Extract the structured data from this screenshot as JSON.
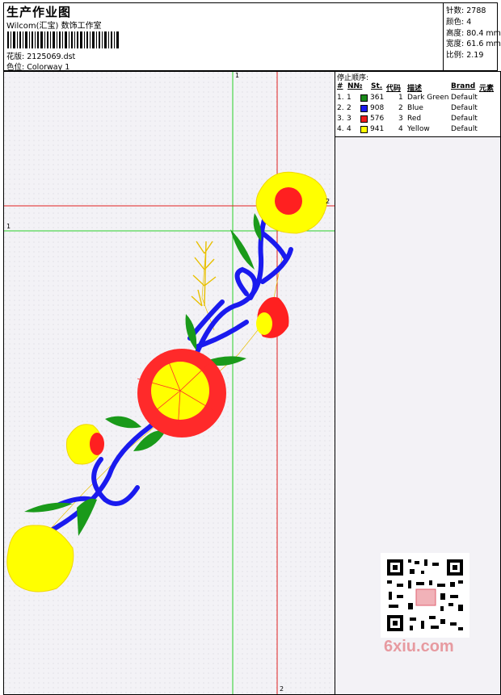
{
  "header": {
    "title": "生产作业图",
    "subtitle": "Wilcom(汇宝) 数饰工作室",
    "design_label": "花版:",
    "design_value": "2125069.dst",
    "colorway_label": "色位:",
    "colorway_value": "Colorway 1"
  },
  "stats": {
    "stitches_label": "针数:",
    "stitches_value": "2788",
    "colors_label": "颜色:",
    "colors_value": "4",
    "height_label": "高度:",
    "height_value": "80.4 mm",
    "width_label": "宽度:",
    "width_value": "61.6 mm",
    "ratio_label": "比例:",
    "ratio_value": "2.19"
  },
  "legend": {
    "title": "停止顺序:",
    "headers": {
      "num": "#",
      "no": "N№",
      "st": "St.",
      "code": "代码",
      "desc": "描述",
      "brand": "Brand",
      "elem": "元素"
    },
    "rows": [
      {
        "num": "1.",
        "no": "1",
        "st": "361",
        "code": "1",
        "desc": "Dark Green",
        "brand": "Default",
        "color": "#1a8a1a"
      },
      {
        "num": "2.",
        "no": "2",
        "st": "908",
        "code": "2",
        "desc": "Blue",
        "brand": "Default",
        "color": "#1a1aee"
      },
      {
        "num": "3.",
        "no": "3",
        "st": "576",
        "code": "3",
        "desc": "Red",
        "brand": "Default",
        "color": "#ee1a1a"
      },
      {
        "num": "4.",
        "no": "4",
        "st": "941",
        "code": "4",
        "desc": "Yellow",
        "brand": "Default",
        "color": "#ffff00"
      }
    ]
  },
  "axes": {
    "green_v": "1",
    "green_h": "1",
    "red_v": "2",
    "red_h": "2"
  },
  "watermark": "6xiu.com",
  "colors": {
    "green_line": "#28d028",
    "red_line": "#e02020",
    "canvas_bg": "#f3f2f6"
  }
}
